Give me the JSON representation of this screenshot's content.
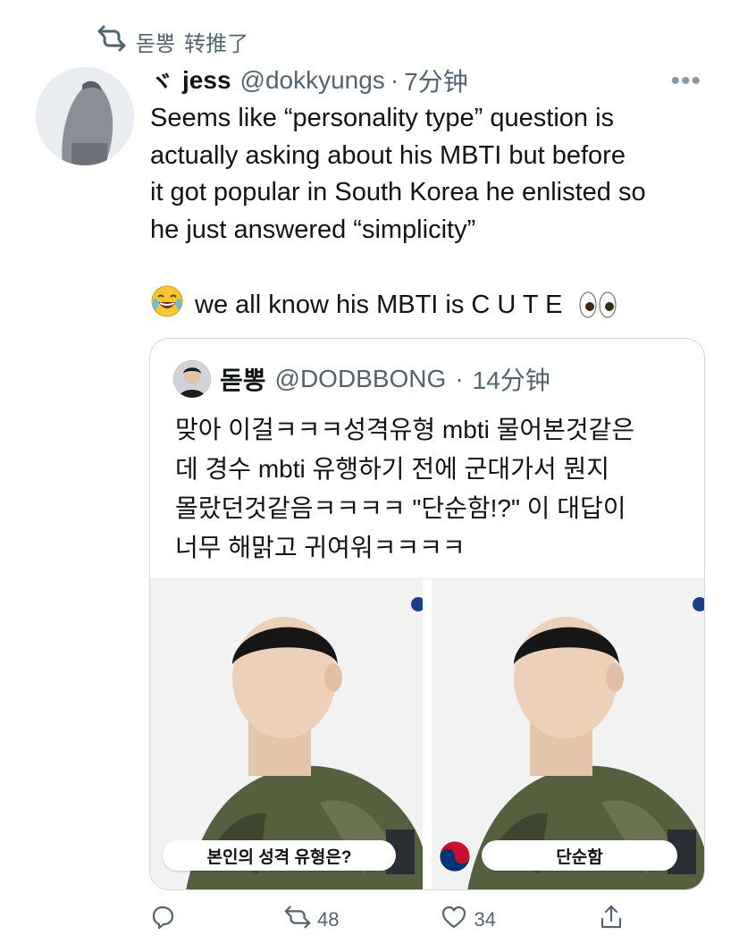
{
  "retweet_context": {
    "user": "돋뽕",
    "action": "转推了"
  },
  "tweet": {
    "display_name_symbol": "ヾ",
    "display_name": "jess",
    "handle": "@dokkyungs",
    "separator": "·",
    "time": "7分钟",
    "more_label": "•••",
    "text_lines": [
      "Seems like “personality type” question is",
      "actually asking about his MBTI but before",
      "it got popular in South Korea he enlisted so",
      "he just answered “simplicity”"
    ],
    "text_line2": "we all know his MBTI is C U T E"
  },
  "quoted_tweet": {
    "display_name": "돋뽕",
    "handle": "@DODBBONG",
    "separator": "·",
    "time": "14分钟",
    "text_lines": [
      "맞아 이걸ㅋㅋㅋ성격유형 mbti 물어본것같은",
      "데 경수 mbti 유행하기 전에 군대가서 뭔지",
      "몰랐던것같음ㅋㅋㅋㅋ \"단순함!?\" 이 대답이",
      "너무 해맑고 귀여워ㅋㅋㅋㅋ"
    ],
    "images": [
      {
        "caption": "본인의 성격 유형은?"
      },
      {
        "caption": "단순함"
      }
    ]
  },
  "actions": {
    "reply_count": "",
    "retweet_count": "48",
    "like_count": "34",
    "share_count": ""
  },
  "colors": {
    "muted": "#536471",
    "border": "#cfd9de"
  },
  "icons": [
    "retweet-icon",
    "more-icon",
    "laugh-emoji-icon",
    "eyes-emoji-icon",
    "reply-icon",
    "like-icon",
    "share-icon"
  ]
}
